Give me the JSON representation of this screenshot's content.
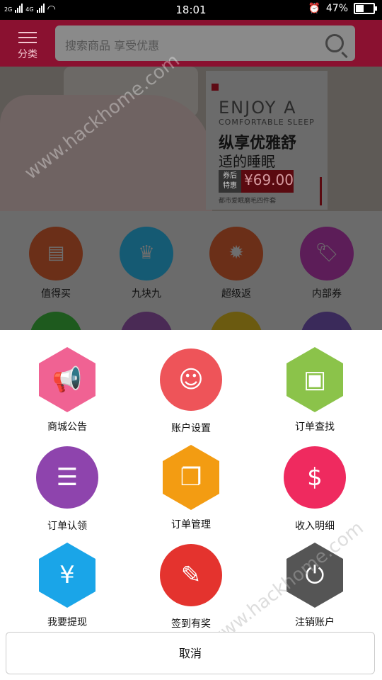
{
  "status_bar": {
    "net1": "2G",
    "net2": "4G",
    "time": "18:01",
    "battery": "47%"
  },
  "header": {
    "category_label": "分类",
    "search_placeholder": "搜索商品 享受优惠"
  },
  "banner": {
    "en_line1": "ENJOY A",
    "en_line2": "COMFORTABLE SLEEP",
    "cn_line1": "纵享优雅舒",
    "cn_line2": "适的睡眠",
    "tag": "券后\n特惠",
    "price": "¥69.00",
    "subtitle": "都市爱眠磨毛四件套"
  },
  "categories": [
    {
      "label": "值得买",
      "color": "#6b2f18",
      "icon": "shop-icon"
    },
    {
      "label": "九块九",
      "color": "#155a73",
      "icon": "crown-icon"
    },
    {
      "label": "超级返",
      "color": "#6b2f18",
      "icon": "sale-icon"
    },
    {
      "label": "内部券",
      "color": "#5c1d58",
      "icon": "tag-icon"
    }
  ],
  "menu": [
    {
      "label": "商城公告",
      "color": "#f06293",
      "shape": "hex",
      "icon": "megaphone-icon"
    },
    {
      "label": "账户设置",
      "color": "#ee5459",
      "shape": "round",
      "icon": "user-icon"
    },
    {
      "label": "订单查找",
      "color": "#8bc34a",
      "shape": "hex",
      "icon": "search-photo-icon"
    },
    {
      "label": "订单认领",
      "color": "#8e44ad",
      "shape": "round",
      "icon": "document-icon"
    },
    {
      "label": "订单管理",
      "color": "#f39c12",
      "shape": "hex",
      "icon": "photos-icon"
    },
    {
      "label": "收入明细",
      "color": "#ef2a5f",
      "shape": "round",
      "icon": "ledger-icon"
    },
    {
      "label": "我要提现",
      "color": "#1aa5e8",
      "shape": "hex",
      "icon": "yen-icon"
    },
    {
      "label": "签到有奖",
      "color": "#e4332e",
      "shape": "round",
      "icon": "pencil-icon"
    },
    {
      "label": "注销账户",
      "color": "#555555",
      "shape": "hex",
      "icon": "power-icon"
    }
  ],
  "cancel_label": "取消",
  "watermark": "www.hackhome.com"
}
